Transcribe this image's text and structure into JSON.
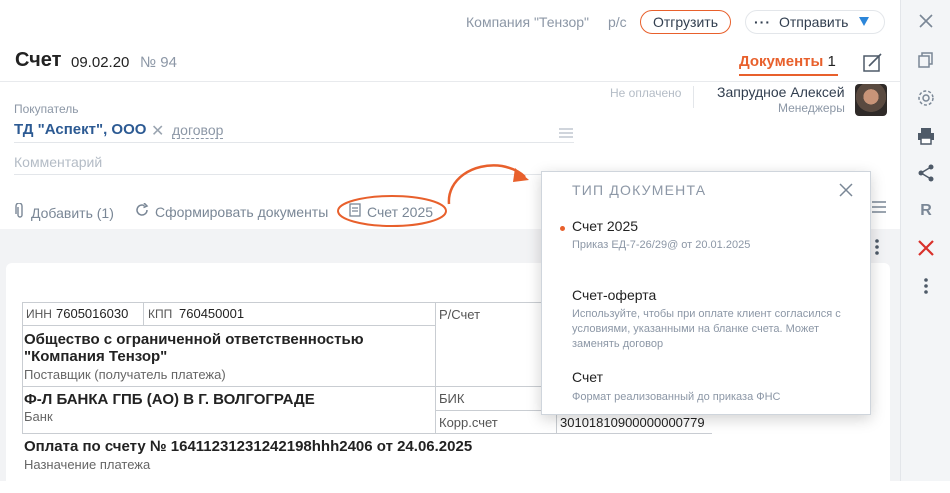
{
  "header": {
    "company": "Компания \"Тензор\"",
    "account_short": "р/с",
    "ship_button": "Отгрузить",
    "send_button": "Отправить",
    "doc_title": "Счет",
    "doc_date": "09.02.20",
    "doc_number": "№ 94",
    "documents_tab": "Документы",
    "documents_count": "1"
  },
  "form": {
    "status": "Не оплачено",
    "manager_name": "Запрудное Алексей",
    "manager_role": "Менеджеры",
    "buyer_label": "Покупатель",
    "buyer_value": "ТД \"Аспект\", ООО",
    "contract_link": "договор",
    "comment_placeholder": "Комментарий"
  },
  "actions": {
    "add": "Добавить (1)",
    "generate": "Сформировать документы",
    "invoice_template": "Счет 2025"
  },
  "invoice": {
    "inn_label": "ИНН",
    "inn": "7605016030",
    "kpp_label": "КПП",
    "kpp": "760450001",
    "account_label": "Р/Счет",
    "company_full_1": "Общество с ограниченной ответственностью",
    "company_full_2": "\"Компания Тензор\"",
    "supplier_caption": "Поставщик (получатель платежа)",
    "bank_name": "Ф-Л БАНКА ГПБ (АО) В Г. ВОЛГОГРАДЕ",
    "bank_caption": "Банк",
    "bik_label": "БИК",
    "corr_label": "Корр.счет",
    "corr_value": "30101810900000000779",
    "payment_text": "Оплата по счету № 16411231231242198hhh2406 от 24.06.2025",
    "payment_caption": "Назначение платежа"
  },
  "popup": {
    "title": "ТИП ДОКУМЕНТА",
    "options": [
      {
        "title": "Счет 2025",
        "desc": "Приказ ЕД-7-26/29@ от 20.01.2025",
        "selected": true
      },
      {
        "title": "Счет-оферта",
        "desc": "Используйте, чтобы при оплате клиент согласился с условиями, указанными на бланке счета. Может заменять договор",
        "selected": false
      },
      {
        "title": "Счет",
        "desc": "Формат реализованный до приказа ФНС",
        "selected": false
      }
    ]
  },
  "colors": {
    "accent": "#e8602c",
    "blue": "#2c5a93",
    "text": "#313e4f",
    "muted": "#8c97a6"
  },
  "rail_icons": [
    "close-icon",
    "copy-icon",
    "settings-icon",
    "print-icon",
    "share-icon",
    "r-icon",
    "delete-icon",
    "more-icon"
  ]
}
